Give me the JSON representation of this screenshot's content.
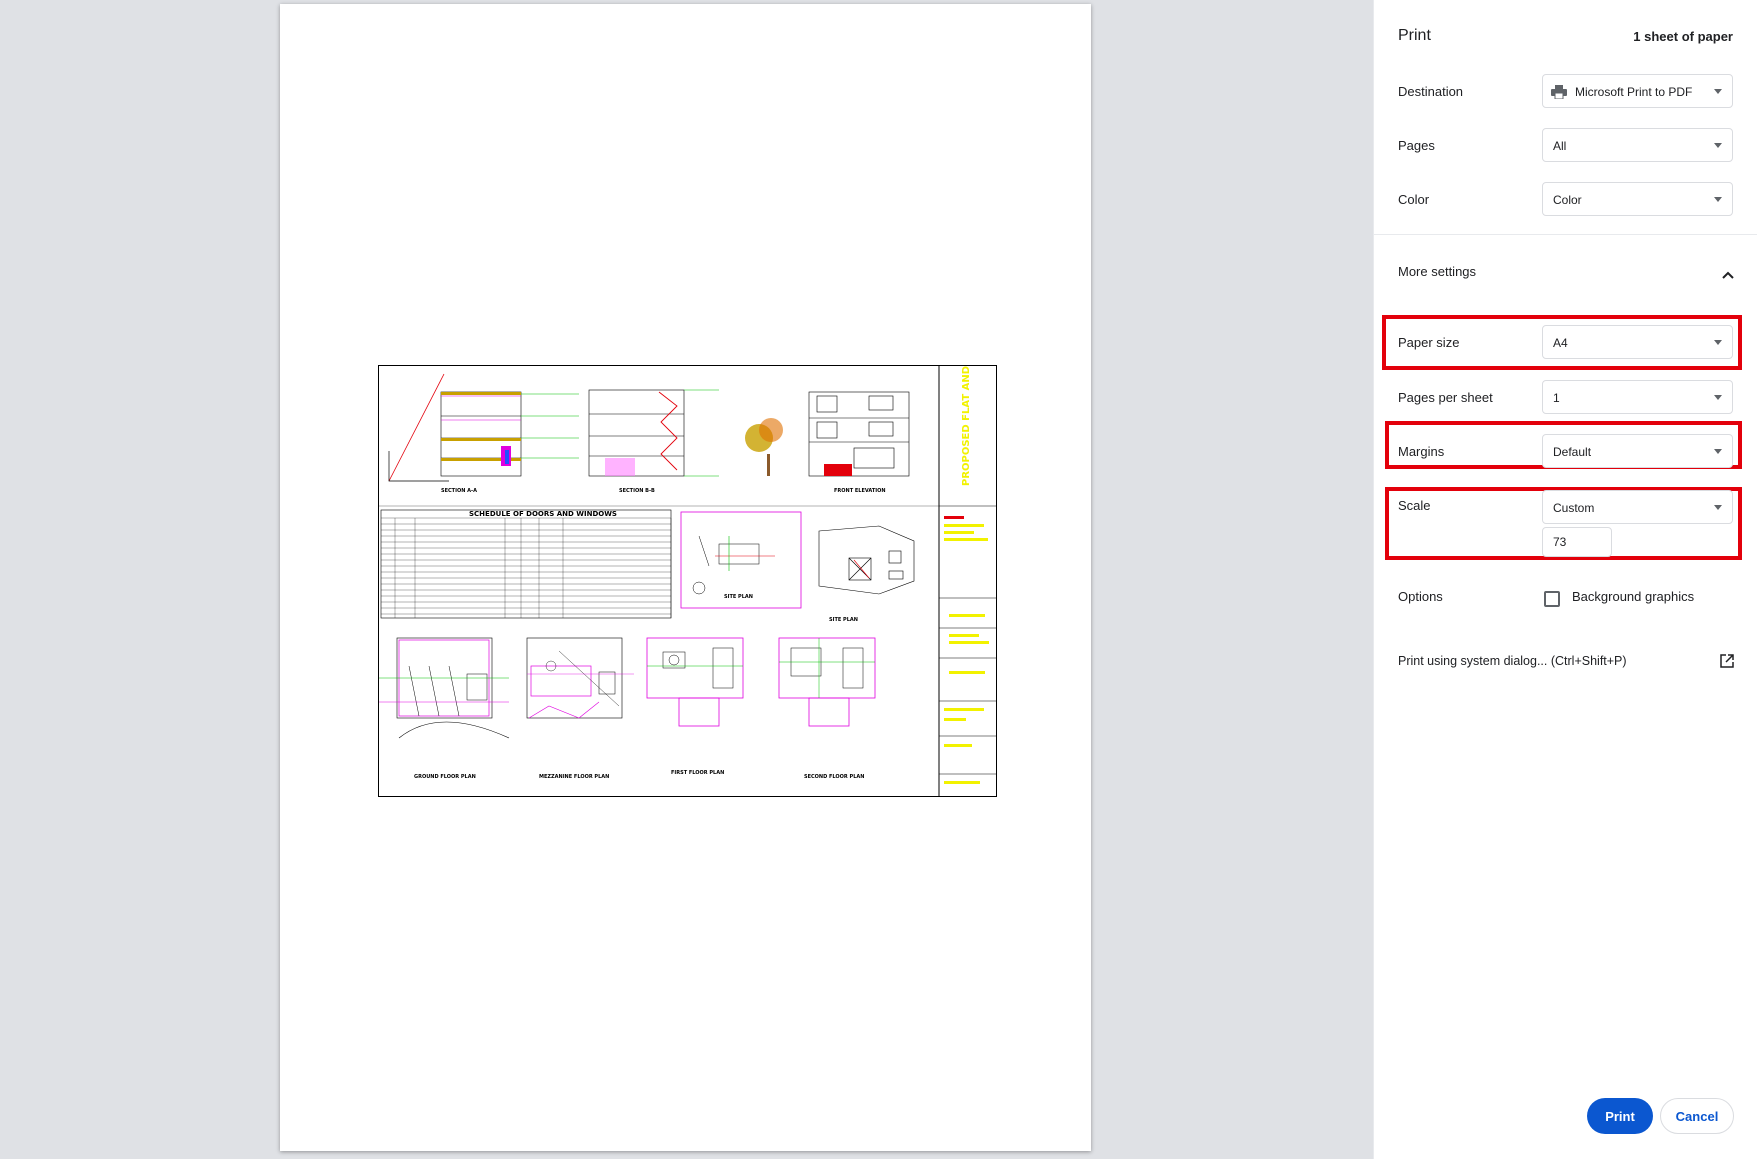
{
  "header": {
    "title": "Print",
    "sheet_count": "1 sheet of paper"
  },
  "destination": {
    "label": "Destination",
    "value": "Microsoft Print to PDF",
    "icon": "printer-icon"
  },
  "pages": {
    "label": "Pages",
    "value": "All"
  },
  "color": {
    "label": "Color",
    "value": "Color"
  },
  "more_settings": {
    "label": "More settings",
    "icon": "chevron-up-icon"
  },
  "paper_size": {
    "label": "Paper size",
    "value": "A4"
  },
  "pages_per_sheet": {
    "label": "Pages per sheet",
    "value": "1"
  },
  "margins": {
    "label": "Margins",
    "value": "Default"
  },
  "scale": {
    "label": "Scale",
    "value": "Custom",
    "custom_value": "73"
  },
  "options": {
    "label": "Options",
    "background_graphics_label": "Background graphics",
    "background_graphics_checked": false
  },
  "system_dialog": {
    "label": "Print using system dialog... (Ctrl+Shift+P)",
    "icon": "open-external-icon"
  },
  "buttons": {
    "print": "Print",
    "cancel": "Cancel"
  },
  "colors": {
    "accent": "#0b57d0",
    "highlight": "#e3000b",
    "preview_bg": "#dfe1e5"
  },
  "drawing": {
    "vertical_title": "PROPOSED FLAT AND OFFICE BUILDING",
    "schedule_title": "SCHEDULE OF DOORS AND WINDOWS",
    "views": {
      "section_aa": "SECTION A-A",
      "section_bb": "SECTION B-B",
      "front_elevation": "FRONT ELEVATION",
      "site_plan_small": "SITE PLAN",
      "site_plan": "SITE PLAN",
      "ground_floor": "GROUND FLOOR PLAN",
      "mezzanine_floor": "MEZZANINE FLOOR PLAN",
      "first_floor": "FIRST FLOOR PLAN",
      "second_floor": "SECOND FLOOR PLAN"
    }
  }
}
